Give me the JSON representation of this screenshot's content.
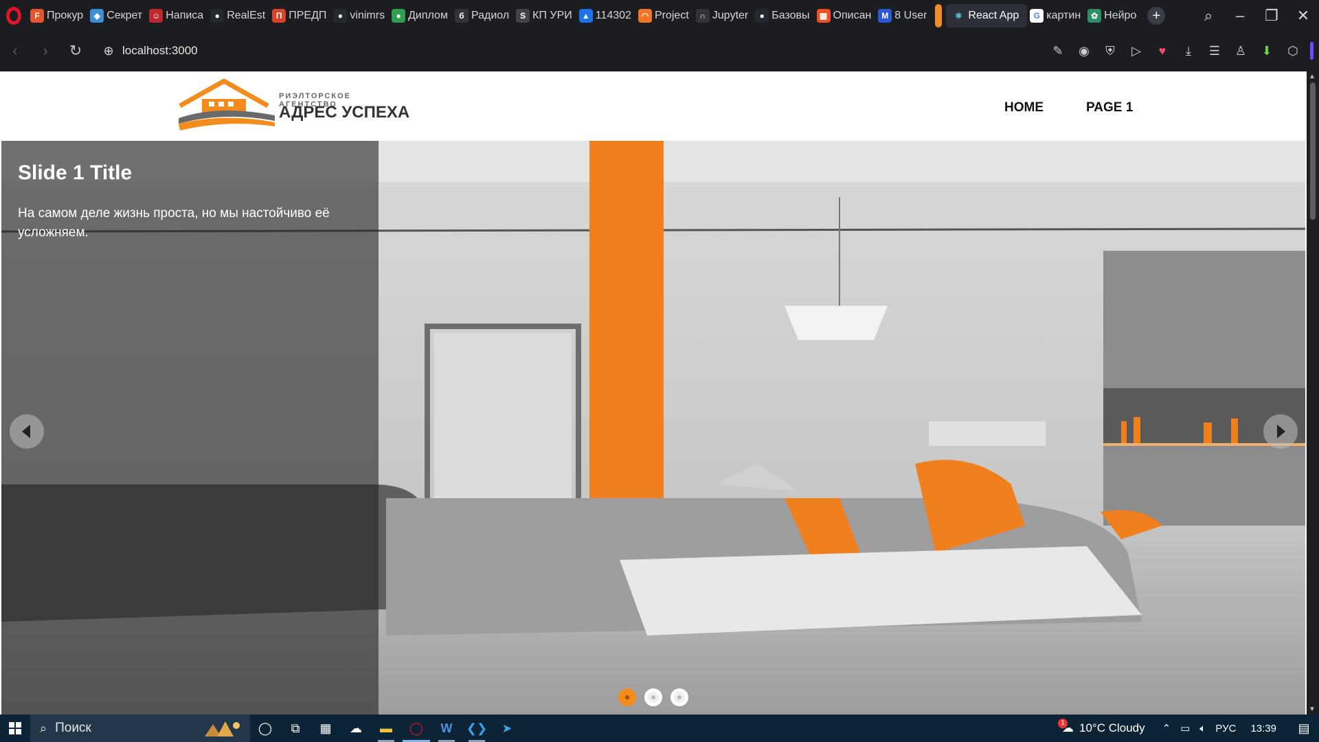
{
  "browser": {
    "tabs": [
      {
        "label": "Прокур",
        "color": "#e8542b",
        "glyph": "F"
      },
      {
        "label": "Секрет",
        "color": "#3a8fd8",
        "glyph": "◆"
      },
      {
        "label": "Написа",
        "color": "#c0282d",
        "glyph": "☺"
      },
      {
        "label": "RealEst",
        "color": "#24292f",
        "glyph": "●"
      },
      {
        "label": "ПРЕДП",
        "color": "#d6452b",
        "glyph": "П"
      },
      {
        "label": "vinimrs",
        "color": "#24292f",
        "glyph": "●"
      },
      {
        "label": "Диплом",
        "color": "#2e9e4f",
        "glyph": "●"
      },
      {
        "label": "Радиол",
        "color": "#333333",
        "glyph": "б"
      },
      {
        "label": "КП УРИ",
        "color": "#444444",
        "glyph": "S"
      },
      {
        "label": "114302",
        "color": "#1a73e8",
        "glyph": "▲"
      },
      {
        "label": "Project",
        "color": "#f37626",
        "glyph": "◠"
      },
      {
        "label": "Jupyter",
        "color": "#333333",
        "glyph": "∩"
      },
      {
        "label": "Базовы",
        "color": "#24292f",
        "glyph": "●"
      },
      {
        "label": "Описан",
        "color": "#f25022",
        "glyph": "▦"
      },
      {
        "label": "8 User",
        "color": "#2b57d6",
        "glyph": "M"
      }
    ],
    "active_tab": {
      "label": "React App",
      "glyph": "⚛"
    },
    "tabs_after": [
      {
        "label": "картин",
        "color": "#ffffff",
        "glyph": "G"
      },
      {
        "label": "Нейро",
        "color": "#2d8f6a",
        "glyph": "✿"
      }
    ],
    "url": "localhost:3000"
  },
  "site": {
    "logo_subtitle": "РИЭЛТОРСКОЕ АГЕНТСТВО",
    "logo_title": "АДРЕС УСПЕХА",
    "nav": {
      "home": "HOME",
      "page1": "PAGE 1"
    }
  },
  "slider": {
    "title": "Slide 1 Title",
    "text": "На самом деле жизнь проста, но мы настойчиво её усложняем.",
    "slide_count": 3,
    "active_index": 0,
    "accent": "#f28c1c"
  },
  "taskbar": {
    "search_placeholder": "Поиск",
    "weather": "10°C Cloudy",
    "weather_badge": "1",
    "language": "РУС",
    "time": "13:39"
  }
}
